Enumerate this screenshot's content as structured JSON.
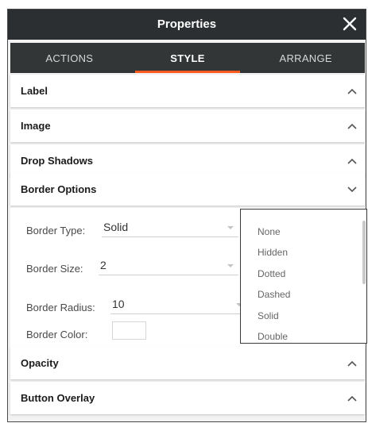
{
  "header": {
    "title": "Properties",
    "close_icon": "close-icon"
  },
  "tabs": [
    {
      "label": "ACTIONS",
      "active": false
    },
    {
      "label": "STYLE",
      "active": true
    },
    {
      "label": "ARRANGE",
      "active": false
    }
  ],
  "sections": {
    "label": "Label",
    "image": "Image",
    "drop_shadows": "Drop Shadows",
    "border_options": "Border Options",
    "opacity": "Opacity",
    "button_overlay": "Button Overlay"
  },
  "border_options": {
    "type": {
      "label": "Border Type:",
      "value": "Solid"
    },
    "size": {
      "label": "Border Size:",
      "value": "2"
    },
    "radius": {
      "label": "Border Radius:",
      "value": "10"
    },
    "color": {
      "label": "Border Color:",
      "value": "#ffffff"
    }
  },
  "dropdown_options": [
    "None",
    "Hidden",
    "Dotted",
    "Dashed",
    "Solid",
    "Double"
  ],
  "colors": {
    "header_bg": "#2b2f31",
    "tab_bg": "#333637",
    "accent": "#ff5a1f"
  }
}
